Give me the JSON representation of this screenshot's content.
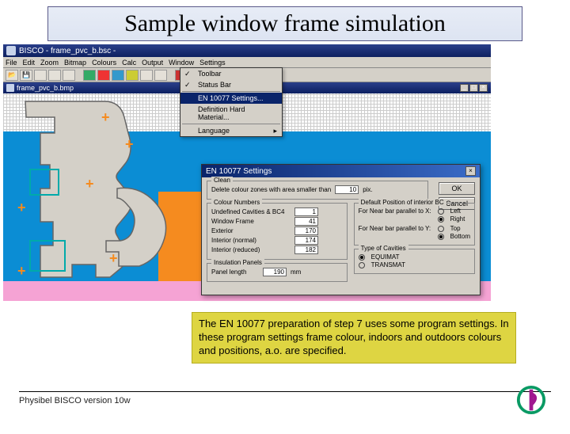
{
  "slide": {
    "title": "Sample window frame simulation"
  },
  "app": {
    "window_title": "BISCO - frame_pvc_b.bsc -",
    "menubar": [
      "File",
      "Edit",
      "Zoom",
      "Bitmap",
      "Colours",
      "Calc",
      "Output",
      "Window",
      "Settings"
    ],
    "doc_tab": "frame_pvc_b.bmp"
  },
  "dropdown": {
    "toolbar": "Toolbar",
    "statusbar": "Status Bar",
    "highlighted": "EN 10077 Settings...",
    "defhard": "Definition Hard Material...",
    "language": "Language"
  },
  "dialog": {
    "title": "EN 10077 Settings",
    "clean_group": "Clean",
    "clean_label": "Delete colour zones with area smaller than",
    "clean_value": "10",
    "clean_unit": "pix.",
    "pos_group": "Default Position of interior BC",
    "nearbar_x": "For Near bar parallel to X:",
    "nearbar_y": "For Near bar parallel to Y:",
    "left": "Left",
    "right": "Right",
    "top": "Top",
    "bottom": "Bottom",
    "colnum_group": "Colour Numbers",
    "undef_cav": "Undefined Cavities & BC4",
    "undef_val": "1",
    "winframe": "Window Frame",
    "winframe_val": "41",
    "exterior": "Exterior",
    "exterior_val": "170",
    "interior_n": "Interior (normal)",
    "interior_n_val": "174",
    "interior_r": "Interior (reduced)",
    "interior_r_val": "182",
    "cavtype_group": "Type of Cavities",
    "equimat": "EQUIMAT",
    "transmat": "TRANSMAT",
    "ins_group": "Insulation Panels",
    "panel_len": "Panel length",
    "panel_len_val": "190",
    "panel_unit": "mm",
    "ok": "OK",
    "cancel": "Cancel"
  },
  "caption": "The EN 10077 preparation of step 7 uses some program settings. In these program settings frame colour, indoors and outdoors colours and positions, a.o. are specified.",
  "footer": "Physibel BISCO version 10w"
}
